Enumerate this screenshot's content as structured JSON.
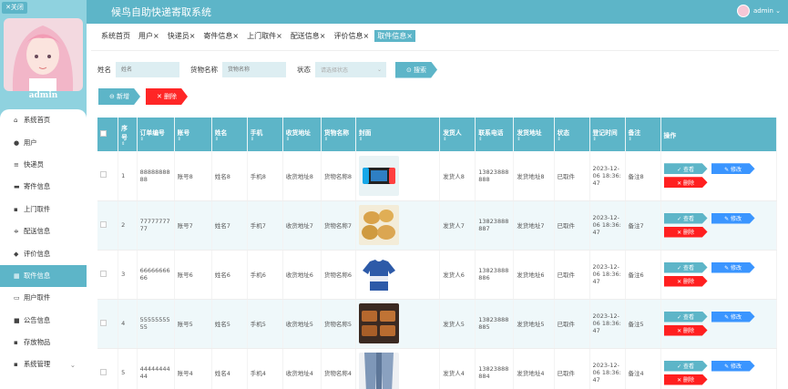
{
  "sidebar": {
    "close_label": "✕关闭",
    "user_name": "admin",
    "items": [
      {
        "label": "系统首页",
        "icon": "home-icon"
      },
      {
        "label": "用户",
        "icon": "user-icon"
      },
      {
        "label": "快递员",
        "icon": "list-icon"
      },
      {
        "label": "寄件信息",
        "icon": "monitor-icon"
      },
      {
        "label": "上门取件",
        "icon": "grid-icon"
      },
      {
        "label": "配送信息",
        "icon": "sliders-icon"
      },
      {
        "label": "评价信息",
        "icon": "pin-icon"
      },
      {
        "label": "取件信息",
        "icon": "calendar-icon",
        "active": true
      },
      {
        "label": "用户取件",
        "icon": "card-icon"
      },
      {
        "label": "公告信息",
        "icon": "video-icon"
      },
      {
        "label": "存放物品",
        "icon": "grid-icon"
      },
      {
        "label": "系统管理",
        "icon": "grid-icon",
        "chevron": "⌄"
      }
    ]
  },
  "header": {
    "title": "候鸟自助快递寄取系统",
    "user": "admin ⌄"
  },
  "tabs": [
    "系统首页",
    "用户×",
    "快递员×",
    "寄件信息×",
    "上门取件×",
    "配送信息×",
    "评价信息×",
    "取件信息×"
  ],
  "search": {
    "name_label": "姓名",
    "name_placeholder": "姓名",
    "goods_label": "货物名称",
    "goods_placeholder": "货物名称",
    "status_label": "状态",
    "status_placeholder": "请选择状态",
    "search_btn": "⊙ 搜索"
  },
  "actions": {
    "add": "⊖ 新增",
    "delete": "✕ 删除"
  },
  "table": {
    "headers": [
      "序号",
      "订单编号",
      "账号",
      "姓名",
      "手机",
      "收货地址",
      "货物名称",
      "封面",
      "发货人",
      "联系电话",
      "发货地址",
      "状态",
      "登记时间",
      "备注",
      "操作"
    ],
    "sort_mark": "⇕",
    "ops": {
      "view": "✓ 查看",
      "edit": "✎ 修改",
      "del": "✕ 删除"
    },
    "rows": [
      {
        "no": "1",
        "order": "8888888888",
        "account": "账号8",
        "name": "姓名8",
        "phone": "手机8",
        "addr": "收货地址8",
        "goods": "货物名称8",
        "cover": "console",
        "sender": "发货人8",
        "tel": "13823888888",
        "saddr": "发货地址8",
        "status": "已取件",
        "time": "2023-12-06 18:36:47",
        "note": "备注8"
      },
      {
        "no": "2",
        "order": "7777777777",
        "account": "账号7",
        "name": "姓名7",
        "phone": "手机7",
        "addr": "收货地址7",
        "goods": "货物名称7",
        "cover": "potato",
        "sender": "发货人7",
        "tel": "13823888887",
        "saddr": "发货地址7",
        "status": "已取件",
        "time": "2023-12-06 18:36:47",
        "note": "备注7"
      },
      {
        "no": "3",
        "order": "6666666666",
        "account": "账号6",
        "name": "姓名6",
        "phone": "手机6",
        "addr": "收货地址6",
        "goods": "货物名称6",
        "cover": "shirt",
        "sender": "发货人6",
        "tel": "13823888886",
        "saddr": "发货地址6",
        "status": "已取件",
        "time": "2023-12-06 18:36:47",
        "note": "备注6"
      },
      {
        "no": "4",
        "order": "5555555555",
        "account": "账号5",
        "name": "姓名5",
        "phone": "手机5",
        "addr": "收货地址5",
        "goods": "货物名称5",
        "cover": "cake",
        "sender": "发货人5",
        "tel": "13823888885",
        "saddr": "发货地址5",
        "status": "已取件",
        "time": "2023-12-06 18:36:47",
        "note": "备注5"
      },
      {
        "no": "5",
        "order": "4444444444",
        "account": "账号4",
        "name": "姓名4",
        "phone": "手机4",
        "addr": "收货地址4",
        "goods": "货物名称4",
        "cover": "jeans",
        "sender": "发货人4",
        "tel": "13823888884",
        "saddr": "发货地址4",
        "status": "已取件",
        "time": "2023-12-06 18:36:47",
        "note": "备注4"
      }
    ]
  }
}
